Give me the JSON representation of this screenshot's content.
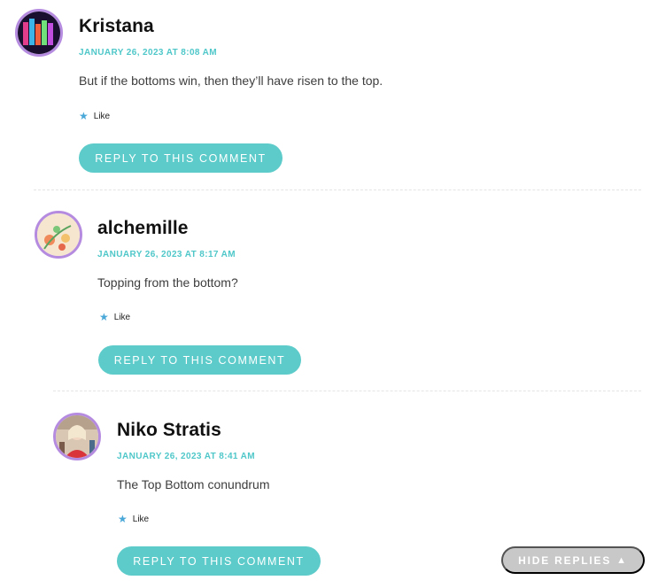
{
  "comments": [
    {
      "author": "Kristana",
      "date": "JANUARY 26, 2023 AT 8:08 AM",
      "text": "But if the bottoms win, then they’ll have risen to the top.",
      "like_label": "Like",
      "reply_label": "REPLY TO THIS COMMENT"
    },
    {
      "author": "alchemille",
      "date": "JANUARY 26, 2023 AT 8:17 AM",
      "text": "Topping from the bottom?",
      "like_label": "Like",
      "reply_label": "REPLY TO THIS COMMENT"
    },
    {
      "author": "Niko Stratis",
      "date": "JANUARY 26, 2023 AT 8:41 AM",
      "text": "The Top Bottom conundrum",
      "like_label": "Like",
      "reply_label": "REPLY TO THIS COMMENT"
    }
  ],
  "hide_replies": {
    "label": "HIDE REPLIES",
    "icon": "caret-up-icon"
  },
  "colors": {
    "accent": "#5ccbc9",
    "date": "#4fc7c9",
    "avatar_border": "#b58be0",
    "like_star": "#4aa8d8",
    "hide_button": "#c8c8c8"
  }
}
